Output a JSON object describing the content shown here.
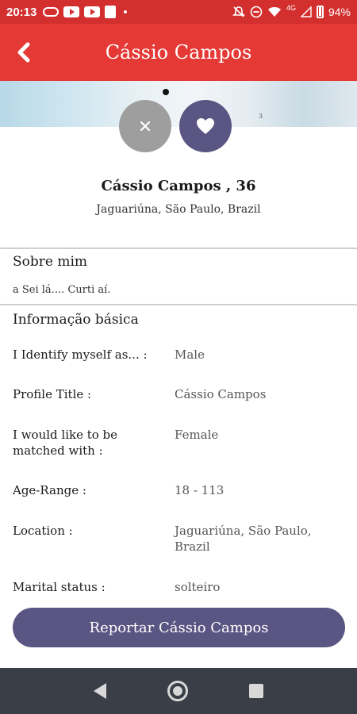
{
  "status_bar": {
    "time": "20:13",
    "network": "4G",
    "battery": "94%"
  },
  "app_bar": {
    "title": "Cássio Campos"
  },
  "profile": {
    "name_age": "Cássio Campos , 36",
    "location": "Jaguariúna, São Paulo, Brazil",
    "photo_mark": "3"
  },
  "about": {
    "title": "Sobre mim",
    "text": "a Sei lá.... Curti aí."
  },
  "basic_info": {
    "title": "Informação básica",
    "rows": [
      {
        "label": "I Identify myself as... :",
        "value": "Male"
      },
      {
        "label": "Profile Title :",
        "value": "Cássio Campos"
      },
      {
        "label": "I would like to be matched with :",
        "value": "Female"
      },
      {
        "label": "Age-Range :",
        "value": "18 - 113"
      },
      {
        "label": "Location :",
        "value": "Jaguariúna, São Paulo, Brazil"
      },
      {
        "label": "Marital status :",
        "value": "solteiro"
      }
    ]
  },
  "report_button": {
    "label": "Reportar Cássio Campos"
  },
  "icons": {
    "back": "arrow-left-icon",
    "dislike": "close-icon",
    "like": "heart-icon",
    "nav_back": "triangle-back-icon",
    "nav_home": "circle-home-icon",
    "nav_recent": "square-recent-icon"
  },
  "colors": {
    "status_bar": "#d32f2f",
    "app_bar": "#e53935",
    "accent": "#5a5582",
    "dislike": "#9e9e9e",
    "nav_bar": "#3a3f47"
  }
}
